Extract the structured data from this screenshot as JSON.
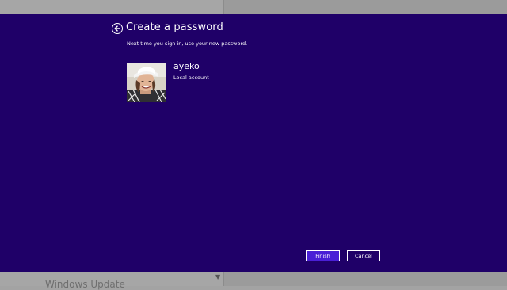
{
  "background": {
    "bottom_text": "Windows Update"
  },
  "dialog": {
    "title": "Create a password",
    "subtitle": "Next time you sign in, use your new password.",
    "user": {
      "name": "ayeko",
      "account_type": "Local account"
    },
    "buttons": {
      "finish_label": "Finish",
      "cancel_label": "Cancel"
    }
  },
  "colors": {
    "dialog_background": "#1f0068",
    "finish_button": "#4a1fd6",
    "text": "#ffffff"
  },
  "icons": {
    "back": "back-arrow-icon",
    "avatar": "user-photo"
  }
}
